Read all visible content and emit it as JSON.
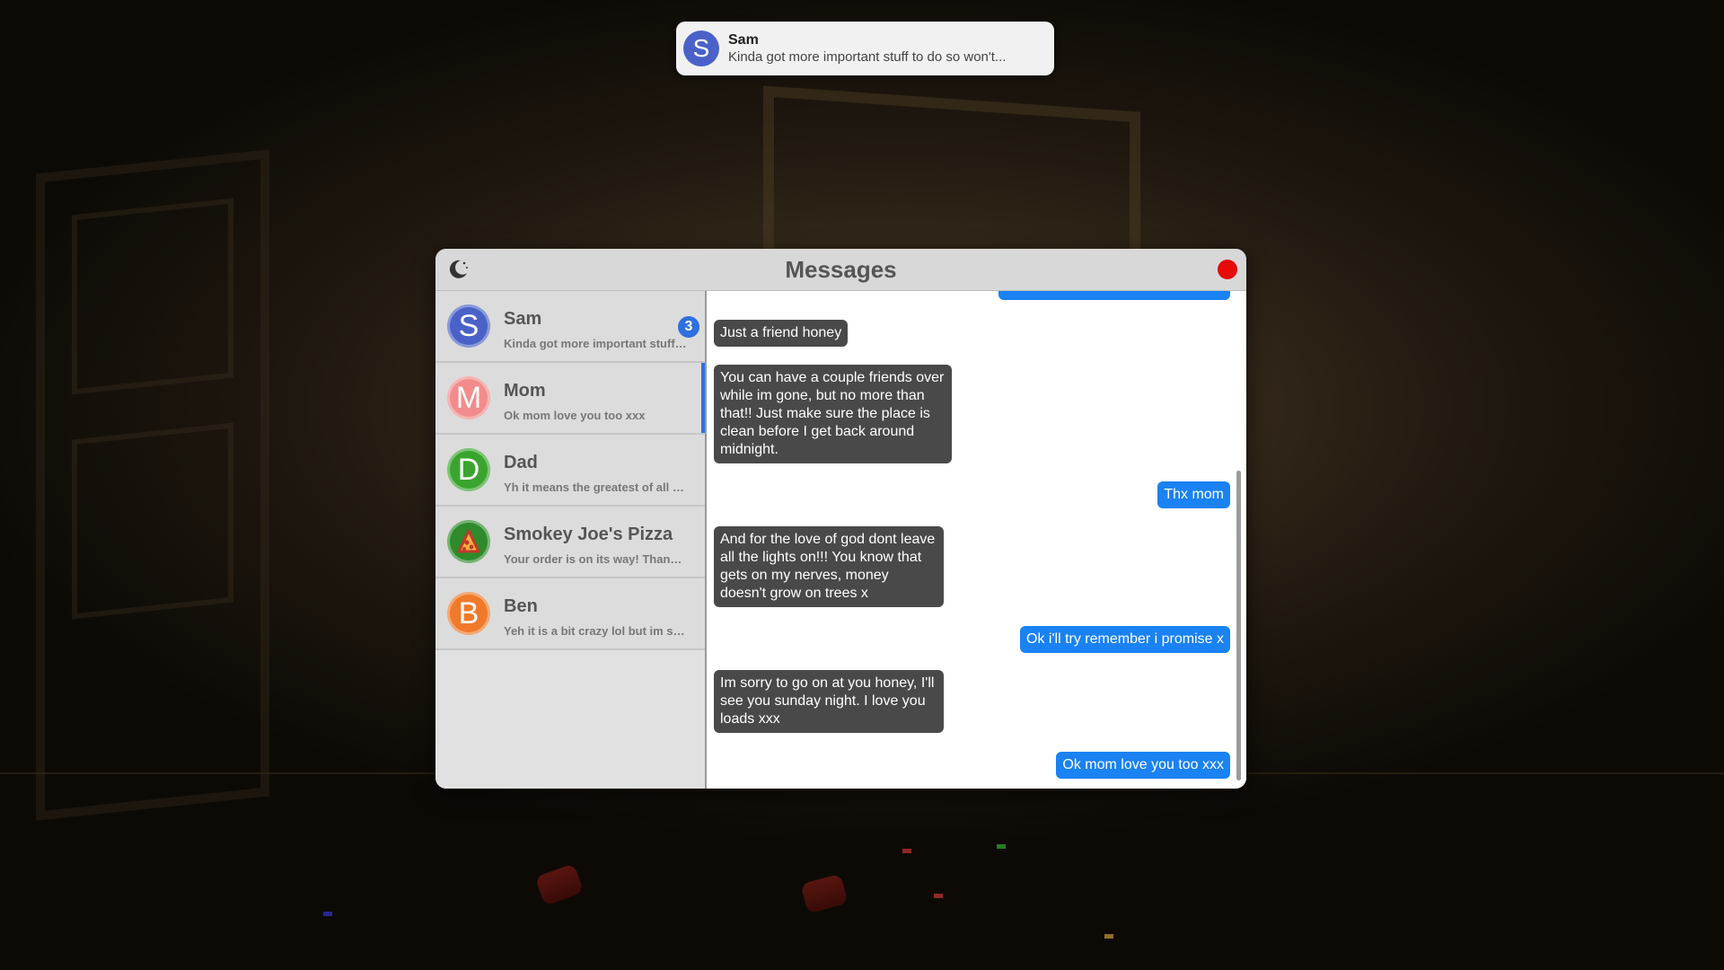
{
  "notification": {
    "avatar_letter": "S",
    "name": "Sam",
    "message": "Kinda got more important stuff to do so won't..."
  },
  "window": {
    "title": "Messages",
    "theme_icon": "moon-icon",
    "close_color": "#e60a0a"
  },
  "contacts": [
    {
      "letter": "S",
      "name": "Sam",
      "preview": "Kinda got more important stuff to...",
      "badge": "3",
      "color": "#4a62c8"
    },
    {
      "letter": "M",
      "name": "Mom",
      "preview": "Ok mom love you too xxx",
      "color": "#f28c8c"
    },
    {
      "letter": "D",
      "name": "Dad",
      "preview": "Yh it means the greatest of all tim...",
      "color": "#3aa52e"
    },
    {
      "letter": "",
      "name": "Smokey Joe's Pizza",
      "preview": "Your order is on its way! Thanks f...",
      "icon": "pizza-icon",
      "color": "#2e8a2a"
    },
    {
      "letter": "B",
      "name": "Ben",
      "preview": "Yeh it is a bit crazy lol but im sure...",
      "color": "#f07a2a"
    }
  ],
  "messages": [
    {
      "from": "them",
      "text": "Just a friend honey"
    },
    {
      "from": "them",
      "text": "You can have a couple friends over while im gone, but no more than that!! Just make sure the place is clean before I get back around midnight."
    },
    {
      "from": "me",
      "text": "Thx mom"
    },
    {
      "from": "them",
      "text": "And for the love of god dont leave all the lights on!!! You know that gets on my nerves, money doesn't grow on trees x"
    },
    {
      "from": "me",
      "text": "Ok i'll try remember i promise x"
    },
    {
      "from": "them",
      "text": "Im sorry to go on at you honey, I'll see you sunday night. I love you loads xxx"
    },
    {
      "from": "me",
      "text": "Ok mom love you too xxx"
    }
  ],
  "colors": {
    "incoming_bubble": "#494949",
    "outgoing_bubble": "#1a82f2",
    "accent": "#2f6fe0"
  }
}
